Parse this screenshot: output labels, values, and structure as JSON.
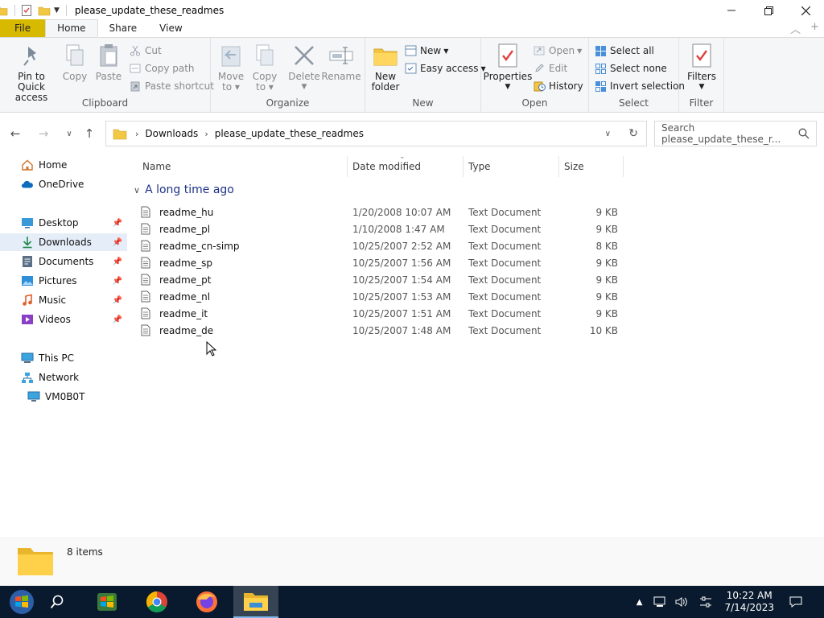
{
  "window": {
    "title": "please_update_these_readmes"
  },
  "ribbon_tabs": [
    {
      "label": "File"
    },
    {
      "label": "Home"
    },
    {
      "label": "Share"
    },
    {
      "label": "View"
    }
  ],
  "ribbon": {
    "clipboard": {
      "group_label": "Clipboard",
      "pin_label_1": "Pin to Quick",
      "pin_label_2": "access",
      "copy": "Copy",
      "paste": "Paste",
      "cut": "Cut",
      "copy_path": "Copy path",
      "paste_shortcut": "Paste shortcut"
    },
    "organize": {
      "group_label": "Organize",
      "move_to_1": "Move",
      "move_to_2": "to",
      "copy_to_1": "Copy",
      "copy_to_2": "to",
      "delete": "Delete",
      "rename": "Rename"
    },
    "new": {
      "group_label": "New",
      "new_folder_1": "New",
      "new_folder_2": "folder",
      "new_item": "New",
      "easy_access": "Easy access"
    },
    "open": {
      "group_label": "Open",
      "properties": "Properties",
      "open": "Open",
      "edit": "Edit",
      "history": "History"
    },
    "select": {
      "group_label": "Select",
      "select_all": "Select all",
      "select_none": "Select none",
      "invert_selection": "Invert selection"
    },
    "filter": {
      "group_label": "Filter",
      "filters": "Filters"
    }
  },
  "address": {
    "crumbs": [
      "Downloads",
      "please_update_these_readmes"
    ],
    "search_placeholder": "Search please_update_these_r..."
  },
  "nav_pane": {
    "items": [
      {
        "label": "Home",
        "icon": "home-icon"
      },
      {
        "label": "OneDrive",
        "icon": "cloud-icon"
      },
      {
        "label": "Desktop",
        "icon": "desktop-icon"
      },
      {
        "label": "Downloads",
        "icon": "download-icon"
      },
      {
        "label": "Documents",
        "icon": "documents-icon"
      },
      {
        "label": "Pictures",
        "icon": "pictures-icon"
      },
      {
        "label": "Music",
        "icon": "music-icon"
      },
      {
        "label": "Videos",
        "icon": "videos-icon"
      },
      {
        "label": "This PC",
        "icon": "computer-icon"
      },
      {
        "label": "Network",
        "icon": "network-icon"
      },
      {
        "label": "VM0B0T",
        "icon": "monitor-icon"
      }
    ]
  },
  "file_list": {
    "columns": [
      "Name",
      "Date modified",
      "Type",
      "Size"
    ],
    "group_label": "A long time ago",
    "rows": [
      {
        "name": "readme_hu",
        "date": "1/20/2008 10:07 AM",
        "type": "Text Document",
        "size": "9 KB"
      },
      {
        "name": "readme_pl",
        "date": "1/10/2008 1:47 AM",
        "type": "Text Document",
        "size": "9 KB"
      },
      {
        "name": "readme_cn-simp",
        "date": "10/25/2007 2:52 AM",
        "type": "Text Document",
        "size": "8 KB"
      },
      {
        "name": "readme_sp",
        "date": "10/25/2007 1:56 AM",
        "type": "Text Document",
        "size": "9 KB"
      },
      {
        "name": "readme_pt",
        "date": "10/25/2007 1:54 AM",
        "type": "Text Document",
        "size": "9 KB"
      },
      {
        "name": "readme_nl",
        "date": "10/25/2007 1:53 AM",
        "type": "Text Document",
        "size": "9 KB"
      },
      {
        "name": "readme_it",
        "date": "10/25/2007 1:51 AM",
        "type": "Text Document",
        "size": "9 KB"
      },
      {
        "name": "readme_de",
        "date": "10/25/2007 1:48 AM",
        "type": "Text Document",
        "size": "10 KB"
      }
    ]
  },
  "status": {
    "item_count": "8 items"
  },
  "taskbar": {
    "time": "10:22 AM",
    "date": "7/14/2023"
  },
  "colors": {
    "file_tab": "#d7b900",
    "group_header": "#1e3287",
    "taskbar": "#0a1a2e",
    "selection": "#e5eef8"
  }
}
